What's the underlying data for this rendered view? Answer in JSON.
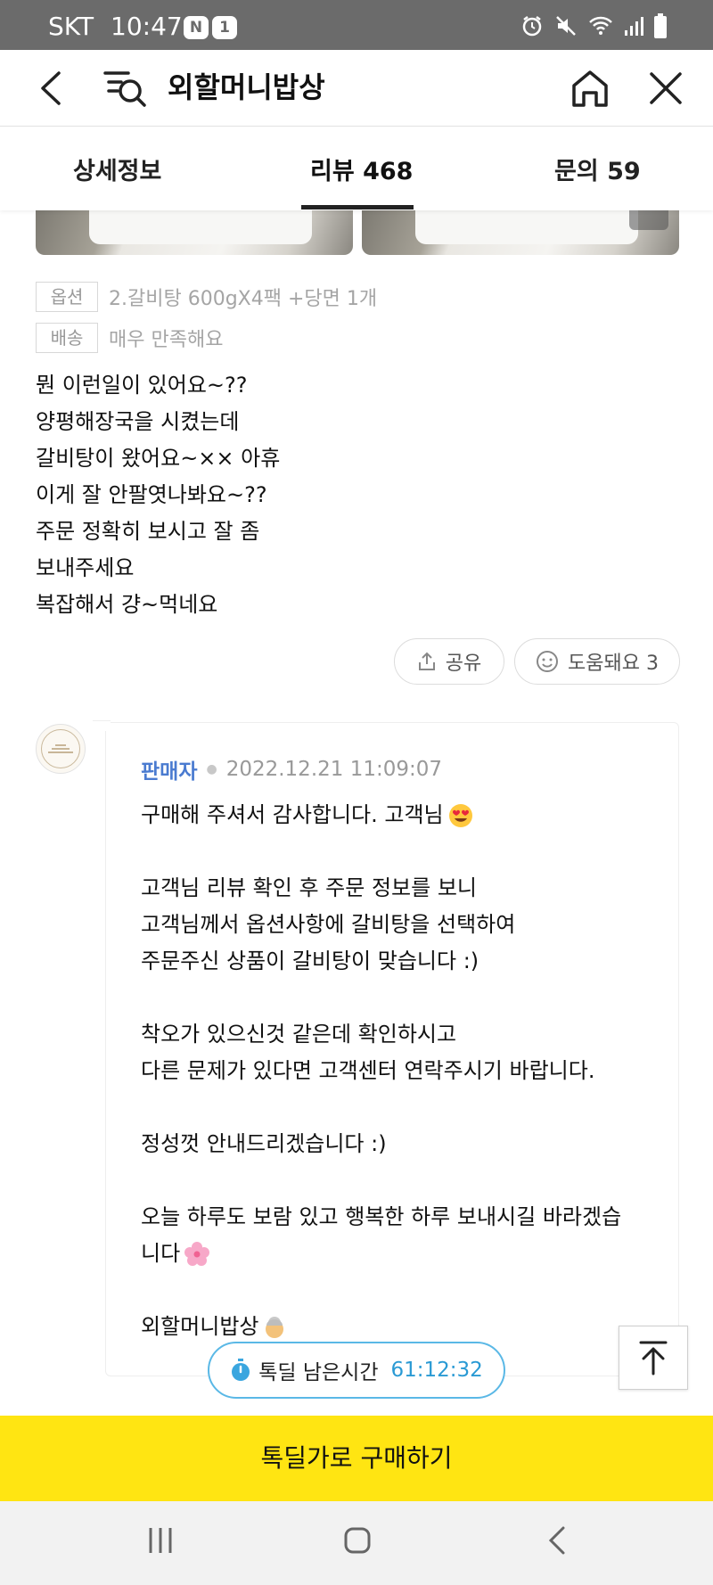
{
  "status_bar": {
    "carrier": "SKT",
    "time": "10:47",
    "badges": [
      "N",
      "1"
    ],
    "icons": [
      "alarm-icon",
      "mute-icon",
      "wifi-icon",
      "signal-icon",
      "battery-icon"
    ]
  },
  "header": {
    "title": "외할머니밥상",
    "icons": [
      "back-icon",
      "search-list-icon",
      "home-icon",
      "close-icon"
    ]
  },
  "tabs": [
    {
      "label": "상세정보",
      "active": false
    },
    {
      "label": "리뷰 468",
      "active": true
    },
    {
      "label": "문의 59",
      "active": false
    }
  ],
  "review": {
    "option_tag": "옵션",
    "option_value": "2.갈비탕 600gX4팩 +당면 1개",
    "delivery_tag": "배송",
    "delivery_value": "매우 만족해요",
    "lines": [
      "뭔 이런일이 있어요~??",
      "양평해장국을 시켰는데",
      "갈비탕이 왔어요~×× 아휴",
      "이게 잘 안팔엿나봐요~??",
      "주문 정확히 보시고 잘 좀",
      "보내주세요",
      "복잡해서 걍~먹네요"
    ],
    "share_label": "공유",
    "helpful_label": "도움돼요 3"
  },
  "seller_reply": {
    "author": "판매자",
    "date": "2022.12.21 11:09:07",
    "avatar_text": "외할머니밥상",
    "lines": [
      "구매해 주셔서 감사합니다. 고객님",
      "",
      "고객님 리뷰 확인 후 주문 정보를 보니",
      "고객님께서 옵션사항에 갈비탕을 선택하여",
      "주문주신 상품이 갈비탕이 맞습니다 :)",
      "",
      "착오가 있으신것 같은데 확인하시고",
      "다른 문제가 있다면 고객센터 연락주시기 바랍니다.",
      "",
      "정성껏 안내드리겠습니다 :)",
      "",
      "오늘 하루도 보람 있고 행복한 하루 보내시길 바라겠습",
      "니다",
      "",
      "외할머니밥상"
    ]
  },
  "timer": {
    "label": "톡딜 남은시간",
    "value": "61:12:32"
  },
  "buy_button": {
    "label": "톡딜가로 구매하기",
    "color": "#ffe512"
  },
  "colors": {
    "accent_blue": "#4a7bd0",
    "timer_blue": "#2a9ad4"
  }
}
